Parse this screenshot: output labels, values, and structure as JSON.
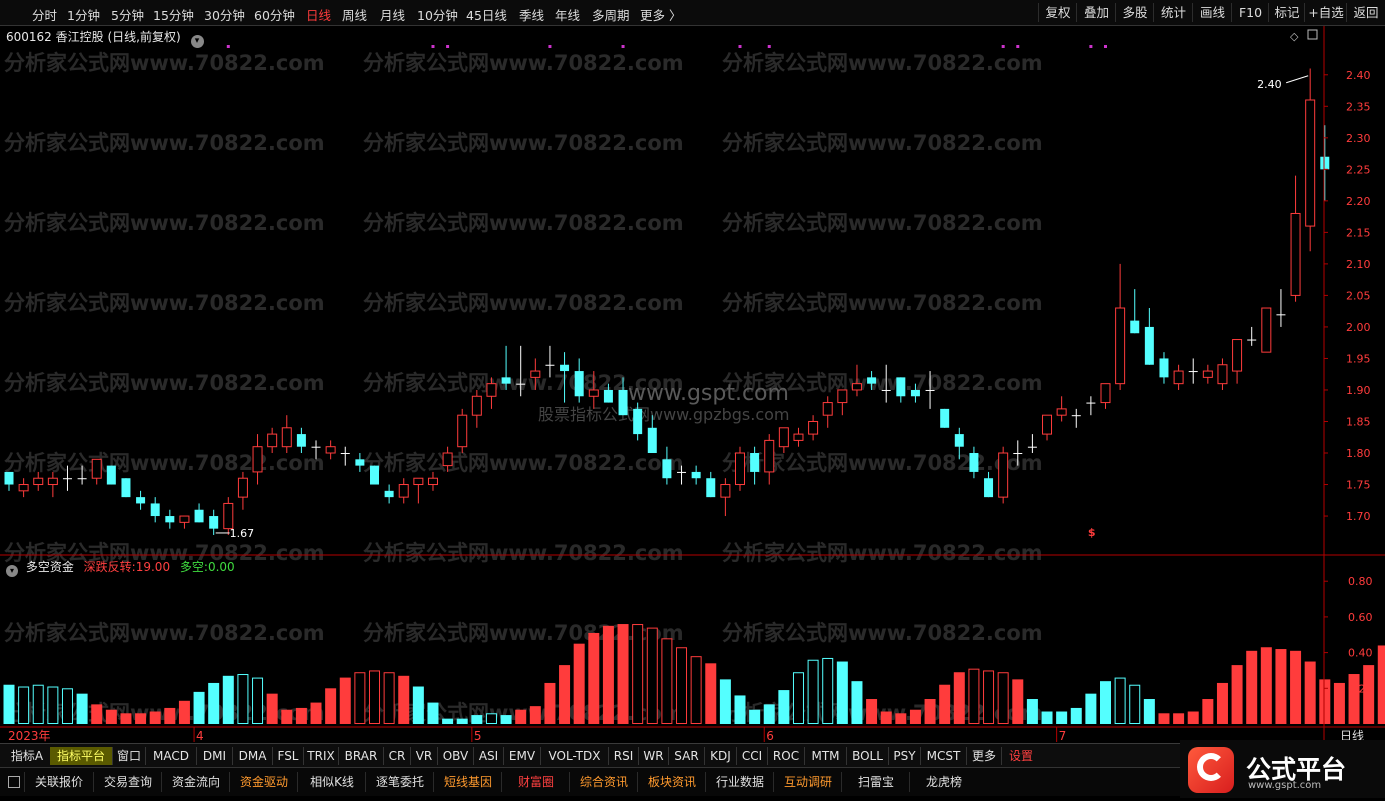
{
  "toolbar": {
    "periods": [
      "分时",
      "1分钟",
      "5分钟",
      "15分钟",
      "30分钟",
      "60分钟",
      "日线",
      "周线",
      "月线",
      "10分钟",
      "45日线",
      "季线",
      "年线",
      "多周期",
      "更多 〉"
    ],
    "active_period": "日线",
    "right_buttons": [
      "复权",
      "叠加",
      "多股",
      "统计",
      "画线",
      "F10",
      "标记",
      "+自选",
      "返回"
    ]
  },
  "stock": {
    "code": "600162",
    "name": "香江控股",
    "mode": "(日线,前复权)"
  },
  "watermarks": {
    "repeat": "分析家公式网www.70822.com",
    "site": "www.gspt.com",
    "site_sub": "股票指标公式网www.gpzbgs.com"
  },
  "colors": {
    "up": "#ff3c3c",
    "down": "#54ffff",
    "doji": "#ffffff",
    "axis": "#b30000",
    "marker": "#cc33cc"
  },
  "indicator_panel": {
    "name": "多空资金",
    "field1_label": "深跌反转:",
    "field1_value": "19.00",
    "field2_label": "多空:",
    "field2_value": "0.00"
  },
  "indicator_tabs": [
    "指标A",
    "指标平台",
    "窗口",
    "MACD",
    "DMI",
    "DMA",
    "FSL",
    "TRIX",
    "BRAR",
    "CR",
    "VR",
    "OBV",
    "ASI",
    "EMV",
    "VOL-TDX",
    "RSI",
    "WR",
    "SAR",
    "KDJ",
    "CCI",
    "ROC",
    "MTM",
    "BOLL",
    "PSY",
    "MCST",
    "更多",
    "设置"
  ],
  "bottom_tabs": [
    "关联报价",
    "交易查询",
    "资金流向",
    "资金驱动",
    "相似K线",
    "逐笔委托",
    "短线基因",
    "财富圈",
    "综合资讯",
    "板块资讯",
    "行业数据",
    "互动调研",
    "扫雷宝",
    "龙虎榜"
  ],
  "logo": {
    "text": "公式平台",
    "url": "www.gspt.com"
  },
  "chart_data": [
    {
      "type": "candlestick",
      "title": "600162 香江控股 (日线,前复权)",
      "y_ticks": [
        1.7,
        1.75,
        1.8,
        1.85,
        1.9,
        1.95,
        2.0,
        2.05,
        2.1,
        2.15,
        2.2,
        2.25,
        2.3,
        2.35,
        2.4
      ],
      "ylim": [
        1.662,
        2.452
      ],
      "x_labels": [
        {
          "i": 0,
          "text": "2023年"
        },
        {
          "i": 13,
          "text": "4"
        },
        {
          "i": 32,
          "text": "5"
        },
        {
          "i": 52,
          "text": "6"
        },
        {
          "i": 72,
          "text": "7"
        },
        {
          "i": 89,
          "text": "日线"
        }
      ],
      "annotations": [
        {
          "i": 89,
          "value": 2.4,
          "text": "2.40"
        },
        {
          "i": 14,
          "value": 1.67,
          "text": "1.67"
        },
        {
          "i": 74,
          "value": 1.675,
          "text": "$"
        }
      ],
      "top_markers": [
        15,
        29,
        30,
        37,
        42,
        50,
        52,
        68,
        69,
        74,
        75
      ],
      "ohlc": [
        [
          1.77,
          1.77,
          1.74,
          1.75
        ],
        [
          1.74,
          1.76,
          1.73,
          1.75
        ],
        [
          1.75,
          1.77,
          1.74,
          1.76
        ],
        [
          1.75,
          1.77,
          1.73,
          1.76
        ],
        [
          1.76,
          1.78,
          1.74,
          1.76
        ],
        [
          1.76,
          1.78,
          1.75,
          1.76
        ],
        [
          1.76,
          1.79,
          1.75,
          1.79
        ],
        [
          1.78,
          1.78,
          1.75,
          1.75
        ],
        [
          1.76,
          1.76,
          1.73,
          1.73
        ],
        [
          1.73,
          1.74,
          1.71,
          1.72
        ],
        [
          1.72,
          1.73,
          1.69,
          1.7
        ],
        [
          1.7,
          1.71,
          1.68,
          1.69
        ],
        [
          1.69,
          1.7,
          1.68,
          1.7
        ],
        [
          1.71,
          1.72,
          1.69,
          1.69
        ],
        [
          1.7,
          1.71,
          1.67,
          1.68
        ],
        [
          1.68,
          1.73,
          1.67,
          1.72
        ],
        [
          1.73,
          1.77,
          1.71,
          1.76
        ],
        [
          1.77,
          1.83,
          1.75,
          1.81
        ],
        [
          1.81,
          1.84,
          1.8,
          1.83
        ],
        [
          1.81,
          1.86,
          1.8,
          1.84
        ],
        [
          1.83,
          1.84,
          1.8,
          1.81
        ],
        [
          1.81,
          1.82,
          1.79,
          1.81
        ],
        [
          1.8,
          1.82,
          1.79,
          1.81
        ],
        [
          1.8,
          1.81,
          1.78,
          1.8
        ],
        [
          1.79,
          1.8,
          1.77,
          1.78
        ],
        [
          1.78,
          1.78,
          1.75,
          1.75
        ],
        [
          1.74,
          1.75,
          1.72,
          1.73
        ],
        [
          1.73,
          1.76,
          1.72,
          1.75
        ],
        [
          1.75,
          1.76,
          1.72,
          1.76
        ],
        [
          1.75,
          1.77,
          1.74,
          1.76
        ],
        [
          1.78,
          1.81,
          1.77,
          1.8
        ],
        [
          1.81,
          1.87,
          1.8,
          1.86
        ],
        [
          1.86,
          1.9,
          1.84,
          1.89
        ],
        [
          1.89,
          1.92,
          1.87,
          1.91
        ],
        [
          1.92,
          1.97,
          1.9,
          1.91
        ],
        [
          1.91,
          1.97,
          1.89,
          1.91
        ],
        [
          1.92,
          1.95,
          1.9,
          1.93
        ],
        [
          1.94,
          1.97,
          1.92,
          1.94
        ],
        [
          1.94,
          1.96,
          1.88,
          1.93
        ],
        [
          1.93,
          1.95,
          1.88,
          1.89
        ],
        [
          1.89,
          1.93,
          1.87,
          1.9
        ],
        [
          1.9,
          1.91,
          1.88,
          1.88
        ],
        [
          1.9,
          1.92,
          1.86,
          1.86
        ],
        [
          1.87,
          1.88,
          1.82,
          1.83
        ],
        [
          1.84,
          1.86,
          1.8,
          1.8
        ],
        [
          1.79,
          1.81,
          1.75,
          1.76
        ],
        [
          1.77,
          1.78,
          1.75,
          1.77
        ],
        [
          1.77,
          1.78,
          1.75,
          1.76
        ],
        [
          1.76,
          1.77,
          1.73,
          1.73
        ],
        [
          1.73,
          1.76,
          1.7,
          1.75
        ],
        [
          1.75,
          1.81,
          1.74,
          1.8
        ],
        [
          1.8,
          1.81,
          1.75,
          1.77
        ],
        [
          1.77,
          1.83,
          1.75,
          1.82
        ],
        [
          1.81,
          1.84,
          1.8,
          1.84
        ],
        [
          1.82,
          1.84,
          1.81,
          1.83
        ],
        [
          1.83,
          1.86,
          1.82,
          1.85
        ],
        [
          1.86,
          1.89,
          1.84,
          1.88
        ],
        [
          1.88,
          1.9,
          1.86,
          1.9
        ],
        [
          1.9,
          1.94,
          1.89,
          1.91
        ],
        [
          1.92,
          1.93,
          1.9,
          1.91
        ],
        [
          1.9,
          1.94,
          1.88,
          1.9
        ],
        [
          1.92,
          1.92,
          1.88,
          1.89
        ],
        [
          1.9,
          1.91,
          1.88,
          1.89
        ],
        [
          1.9,
          1.93,
          1.87,
          1.9
        ],
        [
          1.87,
          1.87,
          1.84,
          1.84
        ],
        [
          1.83,
          1.84,
          1.79,
          1.81
        ],
        [
          1.8,
          1.81,
          1.76,
          1.77
        ],
        [
          1.76,
          1.77,
          1.73,
          1.73
        ],
        [
          1.73,
          1.81,
          1.72,
          1.8
        ],
        [
          1.8,
          1.82,
          1.78,
          1.8
        ],
        [
          1.81,
          1.83,
          1.8,
          1.81
        ],
        [
          1.83,
          1.86,
          1.82,
          1.86
        ],
        [
          1.86,
          1.89,
          1.85,
          1.87
        ],
        [
          1.86,
          1.87,
          1.84,
          1.86
        ],
        [
          1.88,
          1.89,
          1.86,
          1.88
        ],
        [
          1.88,
          1.91,
          1.87,
          1.91
        ],
        [
          1.91,
          2.1,
          1.9,
          2.03
        ],
        [
          2.01,
          2.06,
          1.99,
          1.99
        ],
        [
          2.0,
          2.03,
          1.94,
          1.94
        ],
        [
          1.95,
          1.96,
          1.91,
          1.92
        ],
        [
          1.91,
          1.94,
          1.9,
          1.93
        ],
        [
          1.93,
          1.95,
          1.91,
          1.93
        ],
        [
          1.92,
          1.94,
          1.91,
          1.93
        ],
        [
          1.91,
          1.95,
          1.9,
          1.94
        ],
        [
          1.93,
          1.98,
          1.91,
          1.98
        ],
        [
          1.98,
          2.0,
          1.97,
          1.98
        ],
        [
          1.96,
          2.03,
          1.96,
          2.03
        ],
        [
          2.02,
          2.06,
          2.0,
          2.02
        ],
        [
          2.05,
          2.24,
          2.04,
          2.18
        ],
        [
          2.16,
          2.41,
          2.12,
          2.36
        ],
        [
          2.27,
          2.32,
          2.2,
          2.25
        ]
      ]
    },
    {
      "type": "bar",
      "title": "多空资金",
      "y_ticks": [
        0.2,
        0.4,
        0.6,
        0.8
      ],
      "ylim": [
        0,
        0.93
      ],
      "values": [
        0.22,
        0.21,
        0.22,
        0.21,
        0.2,
        0.17,
        0.11,
        0.08,
        0.06,
        0.06,
        0.07,
        0.09,
        0.13,
        0.18,
        0.23,
        0.27,
        0.28,
        0.26,
        0.17,
        0.08,
        0.09,
        0.12,
        0.2,
        0.26,
        0.29,
        0.3,
        0.29,
        0.27,
        0.21,
        0.12,
        0.03,
        0.03,
        0.05,
        0.06,
        0.05,
        0.08,
        0.1,
        0.23,
        0.33,
        0.45,
        0.51,
        0.55,
        0.56,
        0.56,
        0.54,
        0.48,
        0.43,
        0.38,
        0.34,
        0.25,
        0.16,
        0.08,
        0.11,
        0.19,
        0.29,
        0.36,
        0.37,
        0.35,
        0.24,
        0.14,
        0.07,
        0.06,
        0.08,
        0.14,
        0.22,
        0.29,
        0.31,
        0.3,
        0.29,
        0.25,
        0.14,
        0.07,
        0.07,
        0.09,
        0.17,
        0.24,
        0.26,
        0.22,
        0.14,
        0.06,
        0.06,
        0.07,
        0.14,
        0.23,
        0.33,
        0.41,
        0.43,
        0.42,
        0.41,
        0.35,
        0.25,
        0.23,
        0.28,
        0.33,
        0.44,
        0.62,
        0.86
      ],
      "colors": [
        "down",
        "down",
        "down",
        "down",
        "down",
        "down",
        "up",
        "up",
        "up",
        "up",
        "up",
        "up",
        "up",
        "down",
        "down",
        "down",
        "down",
        "down",
        "up",
        "up",
        "up",
        "up",
        "up",
        "up",
        "up",
        "up",
        "up",
        "up",
        "down",
        "down",
        "down",
        "down",
        "down",
        "down",
        "down",
        "up",
        "up",
        "up",
        "up",
        "up",
        "up",
        "up",
        "up",
        "up",
        "up",
        "up",
        "up",
        "up",
        "up",
        "down",
        "down",
        "down",
        "down",
        "down",
        "down",
        "down",
        "down",
        "down",
        "down",
        "up",
        "up",
        "up",
        "up",
        "up",
        "up",
        "up",
        "up",
        "up",
        "up",
        "up",
        "down",
        "down",
        "down",
        "down",
        "down",
        "down",
        "down",
        "down",
        "down",
        "up",
        "up",
        "up",
        "up",
        "up",
        "up",
        "up",
        "up",
        "up",
        "up",
        "up",
        "up",
        "up",
        "up",
        "up",
        "up",
        "up",
        "up"
      ],
      "filled": [
        true,
        false,
        false,
        false,
        false,
        true,
        true,
        true,
        true,
        true,
        true,
        true,
        true,
        true,
        true,
        true,
        false,
        false,
        true,
        true,
        true,
        true,
        true,
        true,
        false,
        false,
        false,
        true,
        true,
        true,
        true,
        true,
        true,
        false,
        true,
        true,
        true,
        true,
        true,
        true,
        true,
        true,
        true,
        false,
        false,
        false,
        false,
        false,
        true,
        true,
        true,
        true,
        true,
        true,
        false,
        false,
        false,
        true,
        true,
        true,
        true,
        true,
        true,
        true,
        true,
        true,
        false,
        false,
        false,
        true,
        true,
        true,
        true,
        true,
        true,
        true,
        false,
        false,
        true,
        true,
        true,
        true,
        true,
        true,
        true,
        true,
        true,
        true,
        true,
        true,
        true,
        true,
        true,
        true,
        true,
        true,
        true
      ]
    }
  ]
}
